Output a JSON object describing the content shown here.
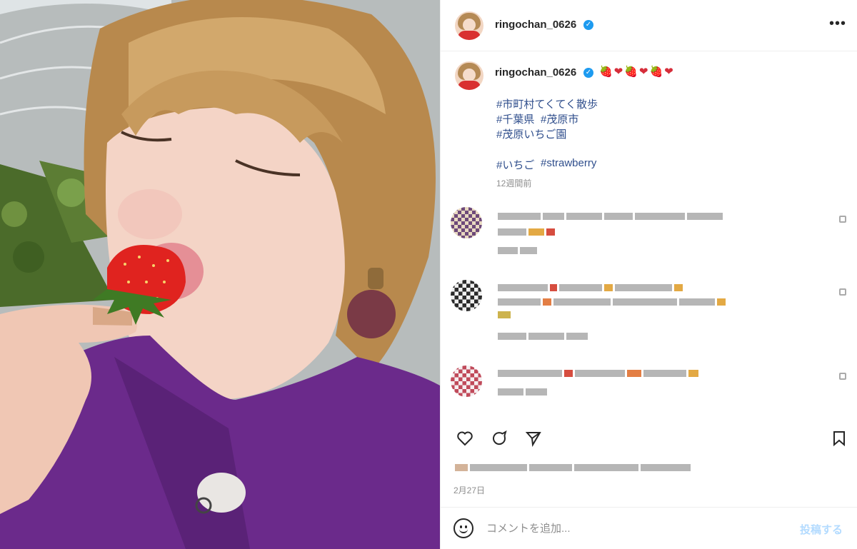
{
  "post": {
    "username": "ringochan_0626",
    "verified_mark": "✓",
    "more_label": "•••",
    "caption_emojis": "🍓❤🍓❤🍓❤",
    "hashtags": [
      "#市町村てくてく散歩",
      "#千葉県",
      "#茂原市",
      "#茂原いちご園",
      "#いちご",
      "#strawberry"
    ],
    "time_ago": "12週間前",
    "date": "2月27日"
  },
  "actions": {
    "like_icon": "heart-icon",
    "comment_icon": "comment-icon",
    "share_icon": "share-icon",
    "save_icon": "bookmark-icon"
  },
  "comment_box": {
    "placeholder": "コメントを追加...",
    "post_label": "投稿する"
  },
  "colors": {
    "link": "#2f4e8c",
    "muted": "#8e8e8e",
    "post_disabled": "#b3dbff",
    "verified": "#1d9bf0"
  }
}
